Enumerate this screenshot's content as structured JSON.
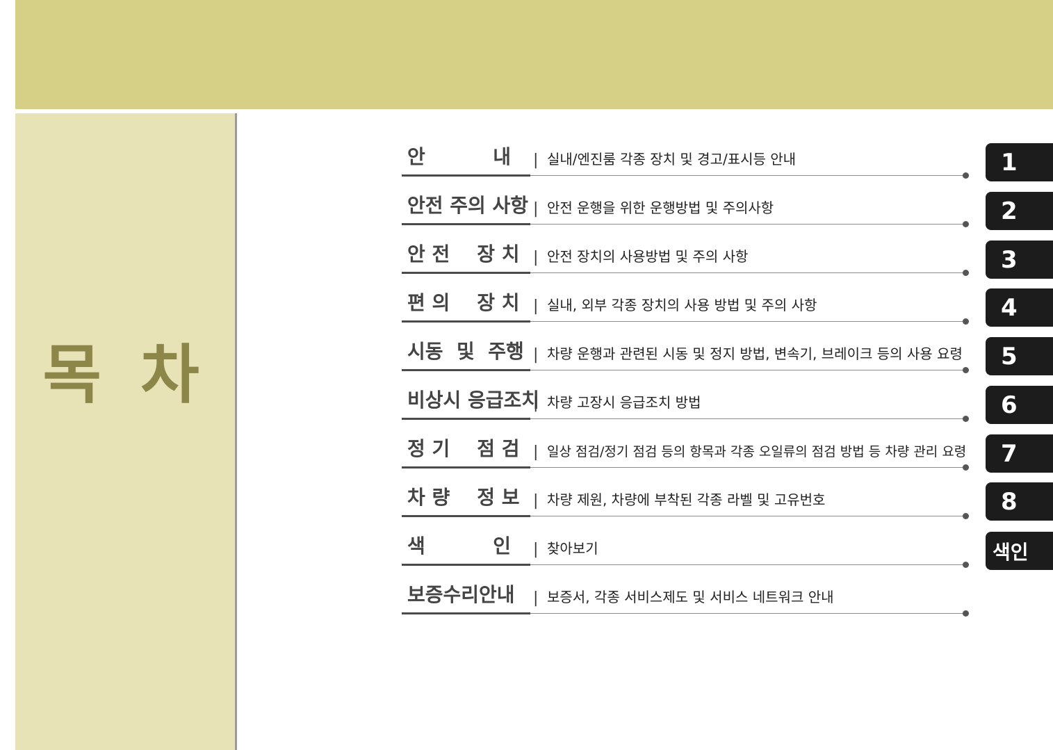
{
  "page": {
    "title": "목 차",
    "colors": {
      "header_band": "#d6cf86",
      "side_panel": "#e8e3b7",
      "title_text": "#8c8648",
      "tab_bg": "#1c1c1c"
    }
  },
  "entries": [
    {
      "heading": "안          내",
      "desc": "실내/엔진룸 각종 장치 및 경고/표시등 안내",
      "tab": "1"
    },
    {
      "heading": "안전 주의 사항",
      "desc": "안전 운행을 위한 운행방법 및 주의사항",
      "tab": "2"
    },
    {
      "heading": "안 전    장 치",
      "desc": "안전 장치의 사용방법 및 주의 사항",
      "tab": "3"
    },
    {
      "heading": "편 의    장 치",
      "desc": "실내, 외부 각종 장치의 사용 방법 및 주의 사항",
      "tab": "4"
    },
    {
      "heading": "시동  및  주행",
      "desc": "차량 운행과 관련된 시동 및 정지 방법, 변속기, 브레이크 등의 사용 요령",
      "tab": "5"
    },
    {
      "heading": "비상시 응급조치",
      "desc": "차량 고장시 응급조치 방법",
      "tab": "6"
    },
    {
      "heading": "정 기    점 검",
      "desc": "일상 점검/정기 점검 등의 항목과 각종 오일류의 점검 방법 등 차량 관리 요령",
      "tab": "7"
    },
    {
      "heading": "차 량    정 보",
      "desc": "차량 제원, 차량에 부착된 각종 라벨 및 고유번호",
      "tab": "8"
    },
    {
      "heading": "색          인",
      "desc": "찾아보기",
      "tab": "색인"
    },
    {
      "heading": "보증수리안내",
      "desc": "보증서, 각종 서비스제도 및 서비스 네트워크 안내",
      "tab": ""
    }
  ],
  "separator": "|"
}
